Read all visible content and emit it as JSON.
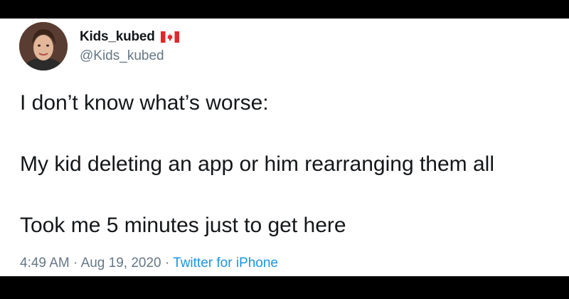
{
  "tweet": {
    "display_name": "Kids_kubed",
    "handle": "@Kids_kubed",
    "flag_icon": "canada-flag-icon",
    "lines": [
      "I don’t know what’s worse:",
      "My kid deleting an app or him rearranging them all",
      "Took me 5 minutes just to get here"
    ],
    "time": "4:49 AM",
    "separator": " · ",
    "date": "Aug 19, 2020",
    "source": "Twitter for iPhone"
  },
  "colors": {
    "background": "#000000",
    "card": "#ffffff",
    "text": "#14171a",
    "secondary": "#657786",
    "link": "#1b95e0",
    "flag_red": "#e0282c"
  }
}
